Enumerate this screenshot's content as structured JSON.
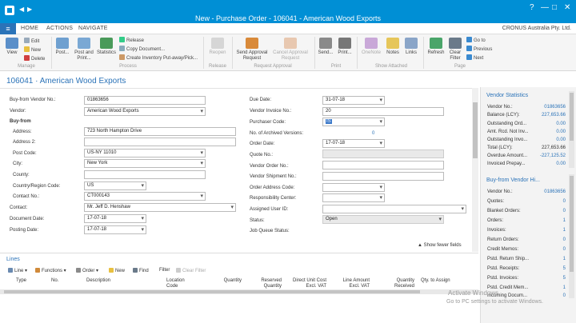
{
  "window": {
    "title": "New - Purchase Order - 106041 - American Wood Exports",
    "controls": [
      "?",
      "—",
      "□",
      "✕"
    ]
  },
  "menu": {
    "file_icon": "menu-icon",
    "tabs": [
      "HOME",
      "ACTIONS",
      "NAVIGATE"
    ],
    "company": "CRONUS Australia Pty. Ltd."
  },
  "ribbon": {
    "manage": {
      "view": "View",
      "edit": "Edit",
      "new": "New",
      "delete": "Delete",
      "group": "Manage"
    },
    "process": {
      "post": "Post...",
      "post_print": "Post and Print...",
      "statistics": "Statistics",
      "release": "Release",
      "copy_document": "Copy Document...",
      "create_inventory": "Create Inventory Put-away/Pick...",
      "group": "Process"
    },
    "release": {
      "reopen": "Reopen",
      "group": "Release"
    },
    "approval": {
      "send": "Send Approval Request",
      "cancel": "Cancel Approval Request",
      "group": "Request Approval"
    },
    "print": {
      "send": "Send...",
      "print": "Print...",
      "group": "Print"
    },
    "attached": {
      "onenote": "OneNote",
      "notes": "Notes",
      "links": "Links",
      "group": "Show Attached"
    },
    "page": {
      "refresh": "Refresh",
      "clear_filter": "Clear Filter",
      "goto": "Go to",
      "previous": "Previous",
      "next": "Next",
      "group": "Page"
    }
  },
  "page": {
    "title": "106041 · American Wood Exports"
  },
  "form": {
    "buy_from_vendor_no": {
      "label": "Buy-from Vendor No.:",
      "value": "01863656"
    },
    "vendor": {
      "label": "Vendor:",
      "value": "American Wood Exports"
    },
    "buy_from_header": "Buy-from",
    "address": {
      "label": "Address:",
      "value": "723 North Hampton Drive"
    },
    "address2": {
      "label": "Address 2:",
      "value": ""
    },
    "post_code": {
      "label": "Post Code:",
      "value": "US-NY 11010"
    },
    "city": {
      "label": "City:",
      "value": "New York"
    },
    "county": {
      "label": "County:",
      "value": ""
    },
    "country": {
      "label": "Country/Region Code:",
      "value": "US"
    },
    "contact_no": {
      "label": "Contact No.:",
      "value": "CT000143"
    },
    "contact": {
      "label": "Contact:",
      "value": "Mr. Jeff D. Henshaw"
    },
    "document_date": {
      "label": "Document Date:",
      "value": "17-07-18"
    },
    "posting_date": {
      "label": "Posting Date:",
      "value": "17-07-18"
    },
    "due_date": {
      "label": "Due Date:",
      "value": "31-07-18"
    },
    "vendor_invoice_no": {
      "label": "Vendor Invoice No.:",
      "value": "20"
    },
    "purchaser_code": {
      "label": "Purchaser Code:",
      "value": "IS"
    },
    "archived_versions": {
      "label": "No. of Archived Versions:",
      "value": "0"
    },
    "order_date": {
      "label": "Order Date:",
      "value": "17-07-18"
    },
    "quote_no": {
      "label": "Quote No.:",
      "value": ""
    },
    "vendor_order_no": {
      "label": "Vendor Order No.:",
      "value": ""
    },
    "vendor_shipment_no": {
      "label": "Vendor Shipment No.:",
      "value": ""
    },
    "order_address_code": {
      "label": "Order Address Code:",
      "value": ""
    },
    "responsibility_center": {
      "label": "Responsibility Center:",
      "value": ""
    },
    "assigned_user_id": {
      "label": "Assigned User ID:",
      "value": ""
    },
    "status": {
      "label": "Status:",
      "value": "Open"
    },
    "job_queue_status": {
      "label": "Job Queue Status:",
      "value": ""
    },
    "show_fewer": "Show fewer fields"
  },
  "vendor_statistics": {
    "title": "Vendor Statistics",
    "rows": [
      {
        "label": "Vendor No.:",
        "value": "01863656"
      },
      {
        "label": "Balance (LCY):",
        "value": "227,653.66"
      },
      {
        "label": "Outstanding Ord...",
        "value": "0.00"
      },
      {
        "label": "Amt. Rcd. Not Inv...",
        "value": "0.00"
      },
      {
        "label": "Outstanding Invo...",
        "value": "0.00"
      },
      {
        "label": "Total (LCY):",
        "value": "227,653.66"
      },
      {
        "label": "Overdue Amount...",
        "value": "-227,125.52"
      },
      {
        "label": "Invoiced Prepay...",
        "value": "0.00"
      }
    ]
  },
  "vendor_history": {
    "title": "Buy-from Vendor Hi...",
    "rows": [
      {
        "label": "Vendor No.:",
        "value": "01863656"
      },
      {
        "label": "Quotes:",
        "value": "0"
      },
      {
        "label": "Blanket Orders:",
        "value": "0"
      },
      {
        "label": "Orders:",
        "value": "1"
      },
      {
        "label": "Invoices:",
        "value": "1"
      },
      {
        "label": "Return Orders:",
        "value": "0"
      },
      {
        "label": "Credit Memos:",
        "value": "0"
      },
      {
        "label": "Pstd. Return Ship...",
        "value": "1"
      },
      {
        "label": "Pstd. Receipts:",
        "value": "5"
      },
      {
        "label": "Pstd. Invoices:",
        "value": "5"
      },
      {
        "label": "Pstd. Credit Mem...",
        "value": "1"
      },
      {
        "label": "Incoming Docum...",
        "value": "0"
      }
    ]
  },
  "lines": {
    "title": "Lines",
    "toolbar": {
      "line": "Line",
      "functions": "Functions",
      "order": "Order",
      "new": "New",
      "find": "Find",
      "filter": "Filter",
      "clear_filter": "Clear Filter"
    },
    "columns": [
      "Type",
      "No.",
      "Description",
      "Location Code",
      "Quantity",
      "Reserved Quantity",
      "Direct Unit Cost Excl. VAT",
      "Line Amount Excl. VAT",
      "Quantity Received",
      "Qty. to Assign"
    ]
  },
  "watermark": {
    "line1": "Activate Windows",
    "line2": "Go to PC settings to activate Windows."
  }
}
